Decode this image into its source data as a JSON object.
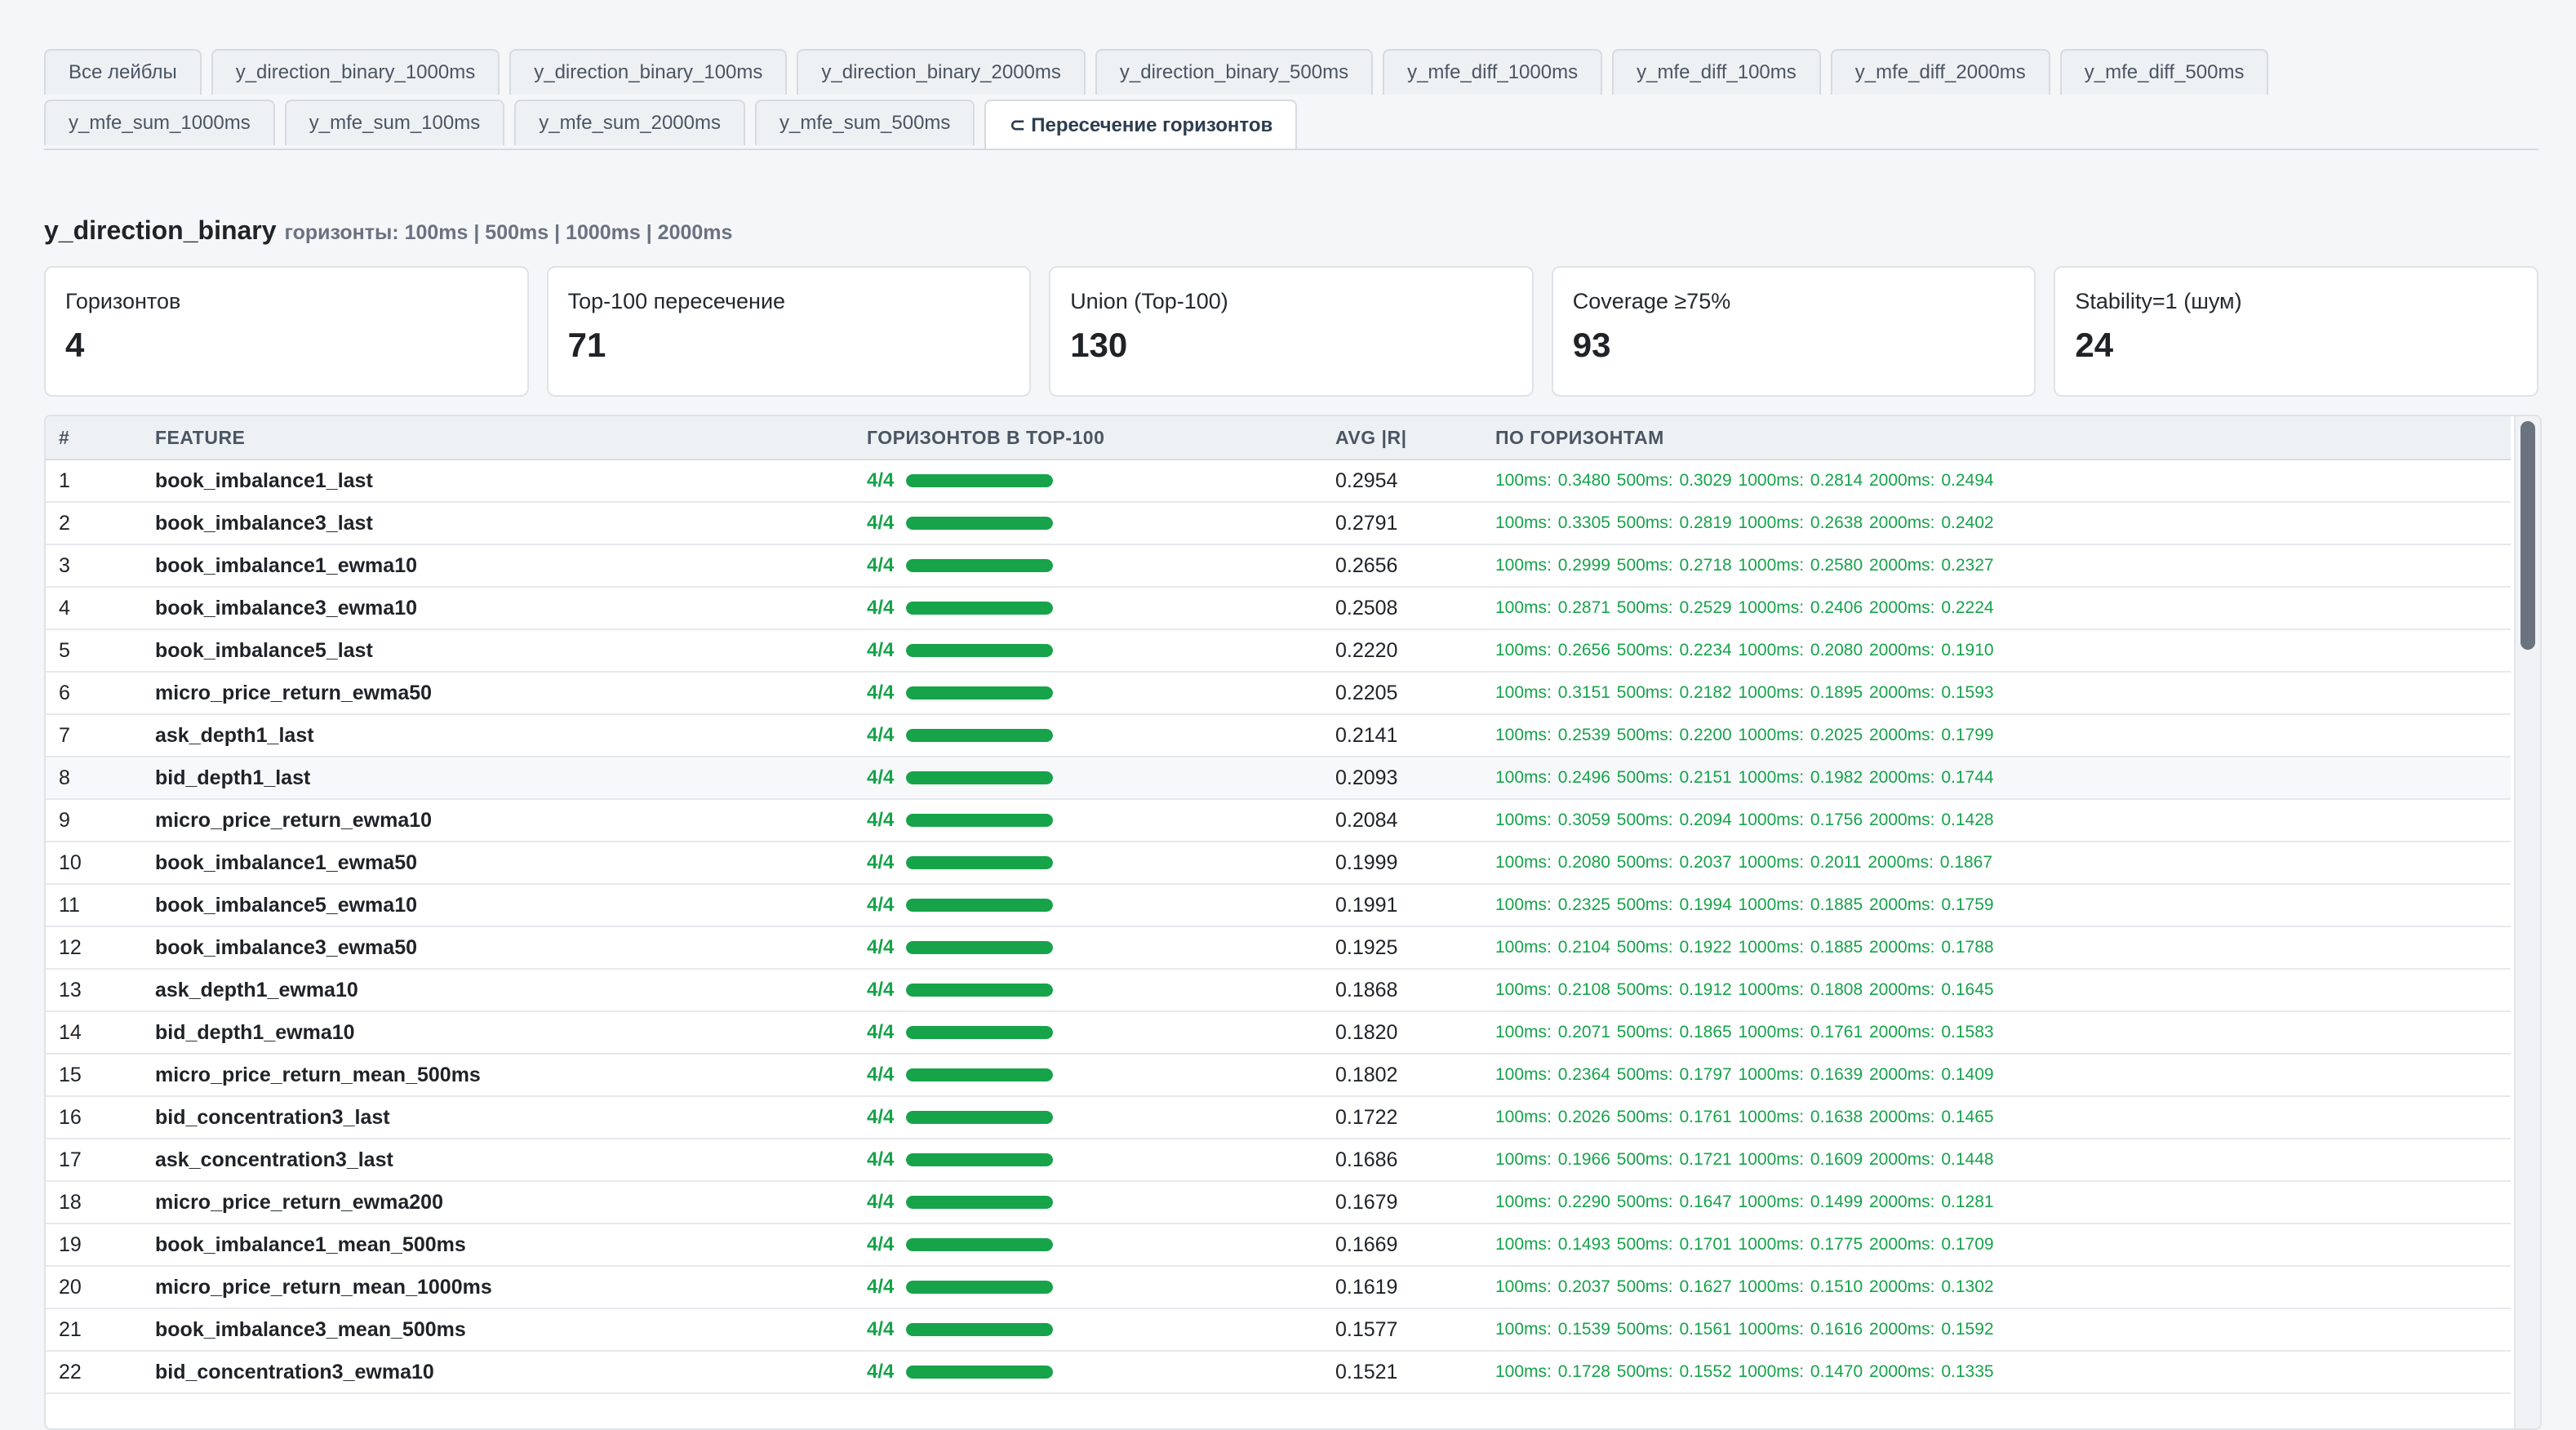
{
  "tabs": {
    "row1": [
      "Все лейблы",
      "y_direction_binary_1000ms",
      "y_direction_binary_100ms",
      "y_direction_binary_2000ms",
      "y_direction_binary_500ms",
      "y_mfe_diff_1000ms",
      "y_mfe_diff_100ms",
      "y_mfe_diff_2000ms",
      "y_mfe_diff_500ms"
    ],
    "row2": [
      "y_mfe_sum_1000ms",
      "y_mfe_sum_100ms",
      "y_mfe_sum_2000ms",
      "y_mfe_sum_500ms"
    ],
    "active_label": "⊂ Пересечение горизонтов"
  },
  "section": {
    "name": "y_direction_binary",
    "horizons": "горизонты: 100ms | 500ms | 1000ms | 2000ms"
  },
  "stats": [
    {
      "label": "Горизонтов",
      "value": "4"
    },
    {
      "label": "Top-100 пересечение",
      "value": "71"
    },
    {
      "label": "Union (Top-100)",
      "value": "130"
    },
    {
      "label": "Coverage ≥75%",
      "value": "93"
    },
    {
      "label": "Stability=1 (шум)",
      "value": "24"
    }
  ],
  "table": {
    "columns": [
      "#",
      "FEATURE",
      "ГОРИЗОНТОВ В TOP-100",
      "AVG |R|",
      "ПО ГОРИЗОНТАМ"
    ],
    "rows": [
      {
        "n": "1",
        "feature": "book_imbalance1_last",
        "count": "4/4",
        "fraction": 1.0,
        "avg": "0.2954",
        "per": "100ms: 0.3480  500ms: 0.3029  1000ms: 0.2814  2000ms: 0.2494"
      },
      {
        "n": "2",
        "feature": "book_imbalance3_last",
        "count": "4/4",
        "fraction": 1.0,
        "avg": "0.2791",
        "per": "100ms: 0.3305  500ms: 0.2819  1000ms: 0.2638  2000ms: 0.2402"
      },
      {
        "n": "3",
        "feature": "book_imbalance1_ewma10",
        "count": "4/4",
        "fraction": 1.0,
        "avg": "0.2656",
        "per": "100ms: 0.2999  500ms: 0.2718  1000ms: 0.2580  2000ms: 0.2327"
      },
      {
        "n": "4",
        "feature": "book_imbalance3_ewma10",
        "count": "4/4",
        "fraction": 1.0,
        "avg": "0.2508",
        "per": "100ms: 0.2871  500ms: 0.2529  1000ms: 0.2406  2000ms: 0.2224"
      },
      {
        "n": "5",
        "feature": "book_imbalance5_last",
        "count": "4/4",
        "fraction": 1.0,
        "avg": "0.2220",
        "per": "100ms: 0.2656  500ms: 0.2234  1000ms: 0.2080  2000ms: 0.1910"
      },
      {
        "n": "6",
        "feature": "micro_price_return_ewma50",
        "count": "4/4",
        "fraction": 1.0,
        "avg": "0.2205",
        "per": "100ms: 0.3151  500ms: 0.2182  1000ms: 0.1895  2000ms: 0.1593"
      },
      {
        "n": "7",
        "feature": "ask_depth1_last",
        "count": "4/4",
        "fraction": 1.0,
        "avg": "0.2141",
        "per": "100ms: 0.2539  500ms: 0.2200  1000ms: 0.2025  2000ms: 0.1799"
      },
      {
        "n": "8",
        "feature": "bid_depth1_last",
        "count": "4/4",
        "fraction": 1.0,
        "avg": "0.2093",
        "per": "100ms: 0.2496  500ms: 0.2151  1000ms: 0.1982  2000ms: 0.1744"
      },
      {
        "n": "9",
        "feature": "micro_price_return_ewma10",
        "count": "4/4",
        "fraction": 1.0,
        "avg": "0.2084",
        "per": "100ms: 0.3059  500ms: 0.2094  1000ms: 0.1756  2000ms: 0.1428"
      },
      {
        "n": "10",
        "feature": "book_imbalance1_ewma50",
        "count": "4/4",
        "fraction": 1.0,
        "avg": "0.1999",
        "per": "100ms: 0.2080  500ms: 0.2037  1000ms: 0.2011  2000ms: 0.1867"
      },
      {
        "n": "11",
        "feature": "book_imbalance5_ewma10",
        "count": "4/4",
        "fraction": 1.0,
        "avg": "0.1991",
        "per": "100ms: 0.2325  500ms: 0.1994  1000ms: 0.1885  2000ms: 0.1759"
      },
      {
        "n": "12",
        "feature": "book_imbalance3_ewma50",
        "count": "4/4",
        "fraction": 1.0,
        "avg": "0.1925",
        "per": "100ms: 0.2104  500ms: 0.1922  1000ms: 0.1885  2000ms: 0.1788"
      },
      {
        "n": "13",
        "feature": "ask_depth1_ewma10",
        "count": "4/4",
        "fraction": 1.0,
        "avg": "0.1868",
        "per": "100ms: 0.2108  500ms: 0.1912  1000ms: 0.1808  2000ms: 0.1645"
      },
      {
        "n": "14",
        "feature": "bid_depth1_ewma10",
        "count": "4/4",
        "fraction": 1.0,
        "avg": "0.1820",
        "per": "100ms: 0.2071  500ms: 0.1865  1000ms: 0.1761  2000ms: 0.1583"
      },
      {
        "n": "15",
        "feature": "micro_price_return_mean_500ms",
        "count": "4/4",
        "fraction": 1.0,
        "avg": "0.1802",
        "per": "100ms: 0.2364  500ms: 0.1797  1000ms: 0.1639  2000ms: 0.1409"
      },
      {
        "n": "16",
        "feature": "bid_concentration3_last",
        "count": "4/4",
        "fraction": 1.0,
        "avg": "0.1722",
        "per": "100ms: 0.2026  500ms: 0.1761  1000ms: 0.1638  2000ms: 0.1465"
      },
      {
        "n": "17",
        "feature": "ask_concentration3_last",
        "count": "4/4",
        "fraction": 1.0,
        "avg": "0.1686",
        "per": "100ms: 0.1966  500ms: 0.1721  1000ms: 0.1609  2000ms: 0.1448"
      },
      {
        "n": "18",
        "feature": "micro_price_return_ewma200",
        "count": "4/4",
        "fraction": 1.0,
        "avg": "0.1679",
        "per": "100ms: 0.2290  500ms: 0.1647  1000ms: 0.1499  2000ms: 0.1281"
      },
      {
        "n": "19",
        "feature": "book_imbalance1_mean_500ms",
        "count": "4/4",
        "fraction": 1.0,
        "avg": "0.1669",
        "per": "100ms: 0.1493  500ms: 0.1701  1000ms: 0.1775  2000ms: 0.1709"
      },
      {
        "n": "20",
        "feature": "micro_price_return_mean_1000ms",
        "count": "4/4",
        "fraction": 1.0,
        "avg": "0.1619",
        "per": "100ms: 0.2037  500ms: 0.1627  1000ms: 0.1510  2000ms: 0.1302"
      },
      {
        "n": "21",
        "feature": "book_imbalance3_mean_500ms",
        "count": "4/4",
        "fraction": 1.0,
        "avg": "0.1577",
        "per": "100ms: 0.1539  500ms: 0.1561  1000ms: 0.1616  2000ms: 0.1592"
      },
      {
        "n": "22",
        "feature": "bid_concentration3_ewma10",
        "count": "4/4",
        "fraction": 1.0,
        "avg": "0.1521",
        "per": "100ms: 0.1728  500ms: 0.1552  1000ms: 0.1470  2000ms: 0.1335"
      }
    ],
    "highlight_row": 8
  },
  "colors": {
    "accent_green": "#16a34a",
    "scroll_thumb": "#6b7280"
  }
}
